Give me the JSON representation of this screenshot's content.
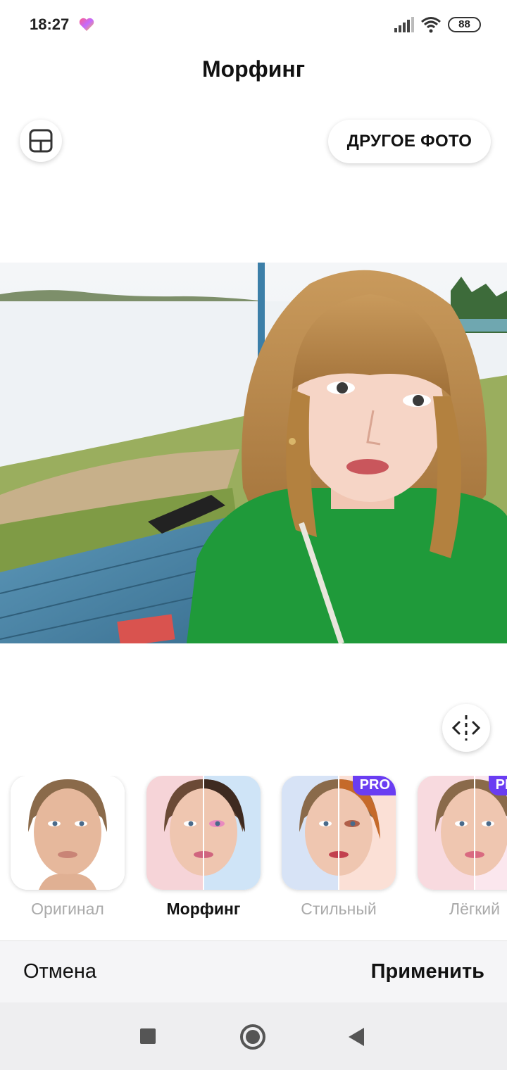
{
  "status_bar": {
    "time": "18:27",
    "battery": "88",
    "icons": [
      "heart-icon",
      "signal-icon",
      "wifi-icon",
      "battery-icon"
    ]
  },
  "header": {
    "title": "Морфинг",
    "layout_icon": "layout-icon",
    "other_photo_label": "ДРУГОЕ ФОТО"
  },
  "photo": {
    "compare_icon": "compare-slider-icon"
  },
  "filters": [
    {
      "label": "Оригинал",
      "selected": false,
      "pro": false
    },
    {
      "label": "Морфинг",
      "selected": true,
      "pro": false
    },
    {
      "label": "Стильный",
      "selected": false,
      "pro": true,
      "badge": "PRO"
    },
    {
      "label": "Лёгкий",
      "selected": false,
      "pro": true,
      "badge": "PRO"
    }
  ],
  "bottom_bar": {
    "cancel_label": "Отмена",
    "apply_label": "Применить"
  },
  "nav_bar": {
    "icons": [
      "recents-icon",
      "home-icon",
      "back-icon"
    ]
  },
  "colors": {
    "pro_badge": "#6a3df2",
    "shirt": "#1f9a3a",
    "water": "#e8eef3",
    "deck": "#4a86a8"
  }
}
